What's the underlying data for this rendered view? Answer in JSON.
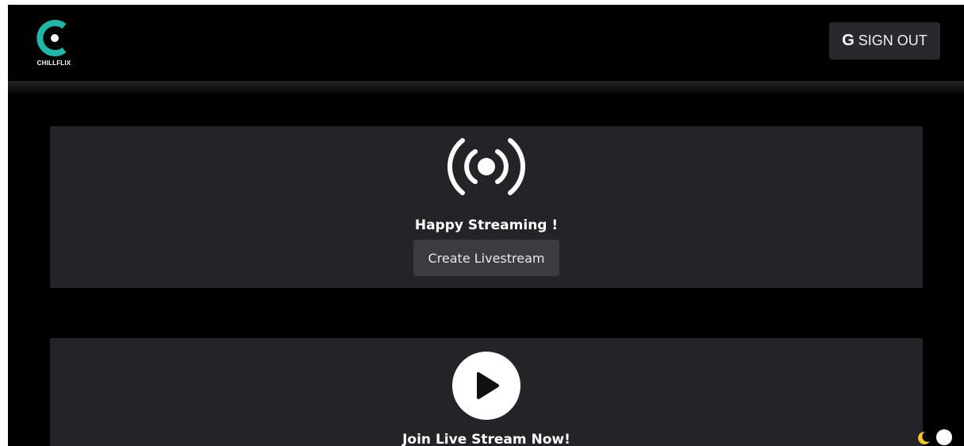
{
  "brand": {
    "name": "CHILLFLIX",
    "accent_color": "#1fb8a8"
  },
  "header": {
    "signout_icon": "google-g-icon",
    "signout_icon_glyph": "G",
    "signout_label": "SIGN OUT"
  },
  "stream_card": {
    "icon": "broadcast-icon",
    "title": "Happy Streaming !",
    "button_label": "Create Livestream"
  },
  "join_card": {
    "icon": "play-icon",
    "title": "Join Live Stream Now!"
  },
  "theme_toggle": {
    "icon": "moon-icon",
    "moon_color": "#f3c623"
  }
}
